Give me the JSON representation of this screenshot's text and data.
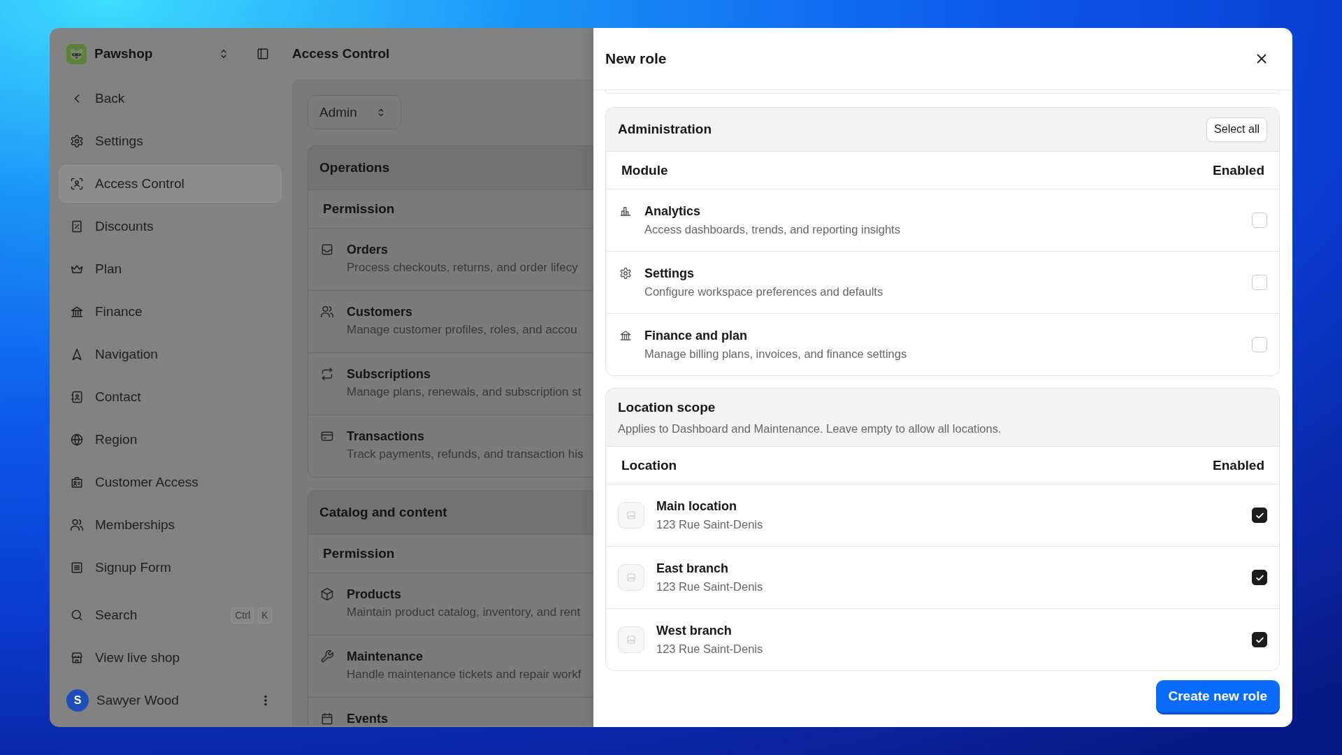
{
  "sidebar": {
    "workspace": "Pawshop",
    "items": [
      {
        "label": "Back",
        "selected": false
      },
      {
        "label": "Settings",
        "selected": false
      },
      {
        "label": "Access Control",
        "selected": true
      },
      {
        "label": "Discounts",
        "selected": false
      },
      {
        "label": "Plan",
        "selected": false
      },
      {
        "label": "Finance",
        "selected": false
      },
      {
        "label": "Navigation",
        "selected": false
      },
      {
        "label": "Contact",
        "selected": false
      },
      {
        "label": "Region",
        "selected": false
      },
      {
        "label": "Customer Access",
        "selected": false
      },
      {
        "label": "Memberships",
        "selected": false
      },
      {
        "label": "Signup Form",
        "selected": false
      }
    ],
    "search": {
      "label": "Search",
      "shortcut": [
        "Ctrl",
        "K"
      ]
    },
    "live_shop": {
      "label": "View live shop"
    },
    "user": {
      "initial": "S",
      "name": "Sawyer Wood"
    }
  },
  "topbar": {
    "title": "Access Control"
  },
  "main": {
    "role_select": {
      "value": "Admin"
    },
    "groups": [
      {
        "title": "Operations",
        "column": "Permission",
        "rows": [
          {
            "title": "Orders",
            "description": "Process checkouts, returns, and order lifecy"
          },
          {
            "title": "Customers",
            "description": "Manage customer profiles, roles, and accou"
          },
          {
            "title": "Subscriptions",
            "description": "Manage plans, renewals, and subscription st"
          },
          {
            "title": "Transactions",
            "description": "Track payments, refunds, and transaction his"
          }
        ]
      },
      {
        "title": "Catalog and content",
        "column": "Permission",
        "rows": [
          {
            "title": "Products",
            "description": "Maintain product catalog, inventory, and rent"
          },
          {
            "title": "Maintenance",
            "description": "Handle maintenance tickets and repair workf"
          },
          {
            "title": "Events"
          }
        ]
      }
    ]
  },
  "dialog": {
    "title": "New role",
    "sections": [
      {
        "kind": "modules",
        "title": "Administration",
        "action": "Select all",
        "columns": [
          "Module",
          "Enabled"
        ],
        "rows": [
          {
            "title": "Analytics",
            "description": "Access dashboards, trends, and reporting insights",
            "checked": false
          },
          {
            "title": "Settings",
            "description": "Configure workspace preferences and defaults",
            "checked": false
          },
          {
            "title": "Finance and plan",
            "description": "Manage billing plans, invoices, and finance settings",
            "checked": false
          }
        ]
      },
      {
        "kind": "locations",
        "title": "Location scope",
        "description": "Applies to Dashboard and Maintenance. Leave empty to allow all locations.",
        "columns": [
          "Location",
          "Enabled"
        ],
        "rows": [
          {
            "title": "Main location",
            "address": "123 Rue Saint-Denis",
            "checked": true
          },
          {
            "title": "East branch",
            "address": "123 Rue Saint-Denis",
            "checked": true
          },
          {
            "title": "West branch",
            "address": "123 Rue Saint-Denis",
            "checked": true
          }
        ]
      }
    ],
    "submit": "Create new role"
  }
}
